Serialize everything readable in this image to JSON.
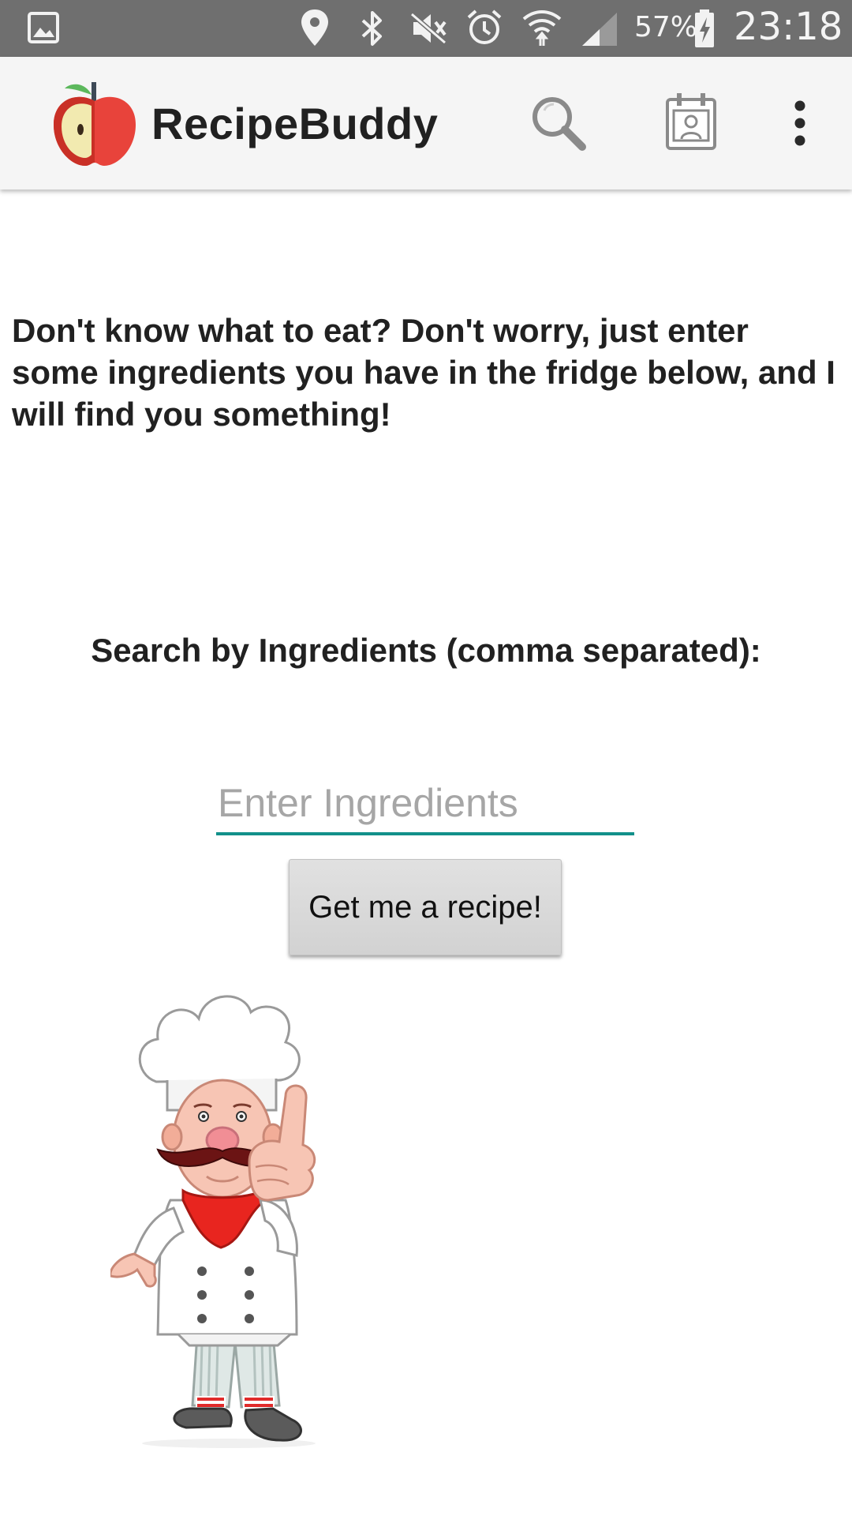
{
  "status_bar": {
    "battery": "57%",
    "time": "23:18",
    "icons": [
      "gallery-icon",
      "location-icon",
      "bluetooth-icon",
      "mute-icon",
      "alarm-icon",
      "wifi-icon",
      "signal-icon",
      "battery-charging-icon"
    ]
  },
  "app_bar": {
    "title": "RecipeBuddy",
    "logo": "apple-icon",
    "actions": [
      "search-icon",
      "calendar-icon",
      "overflow-menu-icon"
    ]
  },
  "main": {
    "intro": "Don't know what to eat? Don't worry, just enter some ingredients you have in the fridge below, and I will find you something!",
    "search_label": "Search by Ingredients (comma separated):",
    "ingredients_input": {
      "value": "",
      "placeholder": "Enter Ingredients"
    },
    "submit_label": "Get me a recipe!",
    "illustration": "chef-illustration"
  },
  "colors": {
    "status_bar": "#6f6f6f",
    "app_bar": "#f5f5f5",
    "accent": "#12908a",
    "button": "#d9d9d9"
  }
}
